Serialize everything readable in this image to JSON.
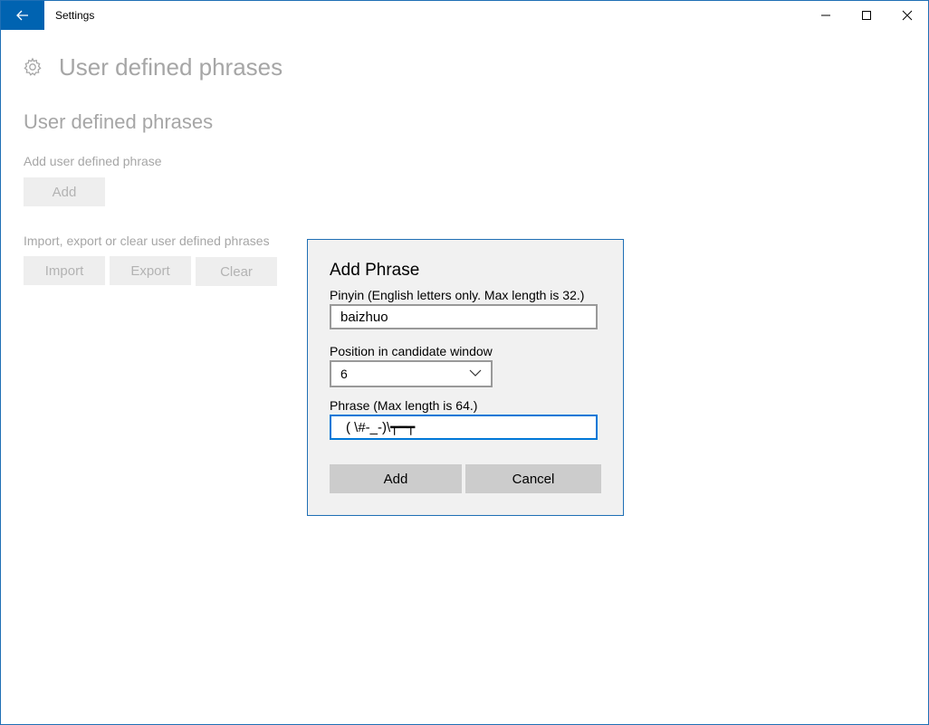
{
  "window": {
    "title": "Settings",
    "icons": {
      "back": "back-arrow-icon",
      "minimize": "minimize-icon",
      "maximize": "maximize-icon",
      "close": "close-icon"
    },
    "accent": "#0063b1"
  },
  "page": {
    "header_icon": "gear-icon",
    "title": "User defined phrases",
    "section_title": "User defined phrases",
    "add_label": "Add user defined phrase",
    "add_button": "Add",
    "import_label": "Import, export or clear user defined phrases",
    "import_button": "Import",
    "export_button": "Export",
    "clear_button": "Clear"
  },
  "dialog": {
    "title": "Add Phrase",
    "pinyin_label": "Pinyin (English letters only. Max length is 32.)",
    "pinyin_value": "baizhuo",
    "position_label": "Position in candidate window",
    "position_value": "6",
    "phrase_label": "Phrase (Max length is 64.)",
    "phrase_value": "( \\#-_-)\\┯━┯",
    "add_button": "Add",
    "cancel_button": "Cancel"
  }
}
